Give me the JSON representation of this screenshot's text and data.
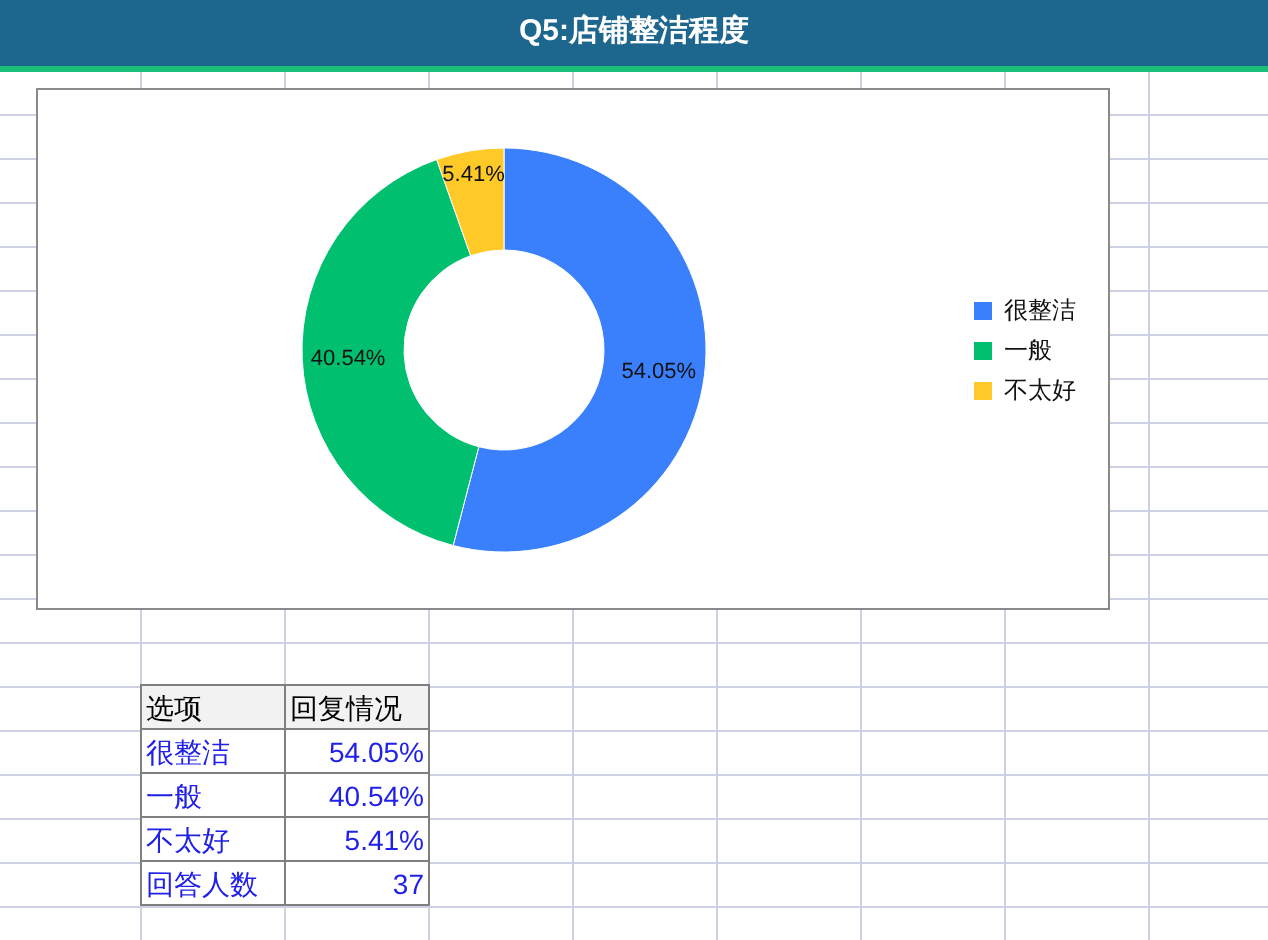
{
  "header": {
    "title": "Q5:店铺整洁程度"
  },
  "chart": {
    "chart_data": {
      "type": "donut",
      "categories": [
        "很整洁",
        "一般",
        "不太好"
      ],
      "values": [
        54.05,
        40.54,
        5.41
      ],
      "colors": [
        "#3a7ffc",
        "#00bf6f",
        "#ffca28"
      ],
      "data_labels": true,
      "value_labels": [
        "54.05%",
        "40.54%",
        "5.41%"
      ],
      "legend": "right"
    }
  },
  "table": {
    "columns": [
      "选项",
      "回复情况"
    ],
    "rows": [
      {
        "label": "很整洁",
        "value": "54.05%"
      },
      {
        "label": "一般",
        "value": "40.54%"
      },
      {
        "label": "不太好",
        "value": "5.41%"
      },
      {
        "label": "回答人数",
        "value": "37"
      }
    ]
  }
}
